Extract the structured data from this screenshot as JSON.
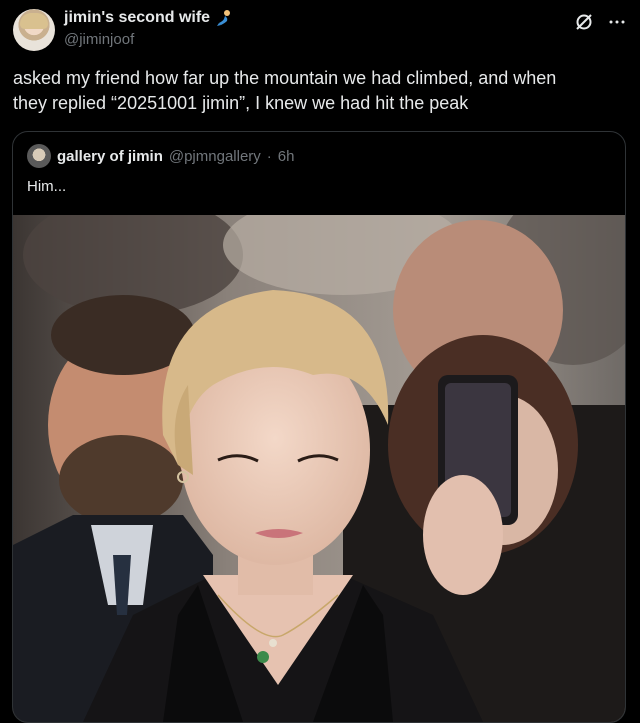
{
  "author": {
    "display_name": "jimin's second wife",
    "handle": "@jiminjoof",
    "emoji": "merperson-emoji"
  },
  "tweet": {
    "text_line1": "asked my friend how far up the mountain we had climbed, and when",
    "text_line2": "they replied “20251001 jimin”, I knew we had hit the peak"
  },
  "quoted": {
    "display_name": "gallery of jimin",
    "handle": "@pjmngallery",
    "separator": "·",
    "time": "6h",
    "text": "Him..."
  },
  "icons": {
    "grok": "grok-icon",
    "more": "more-icon",
    "more_glyph": "···"
  },
  "colors": {
    "background": "#000000",
    "primary_text": "#e7e9ea",
    "secondary_text": "#71767b",
    "border": "#2f3336"
  }
}
